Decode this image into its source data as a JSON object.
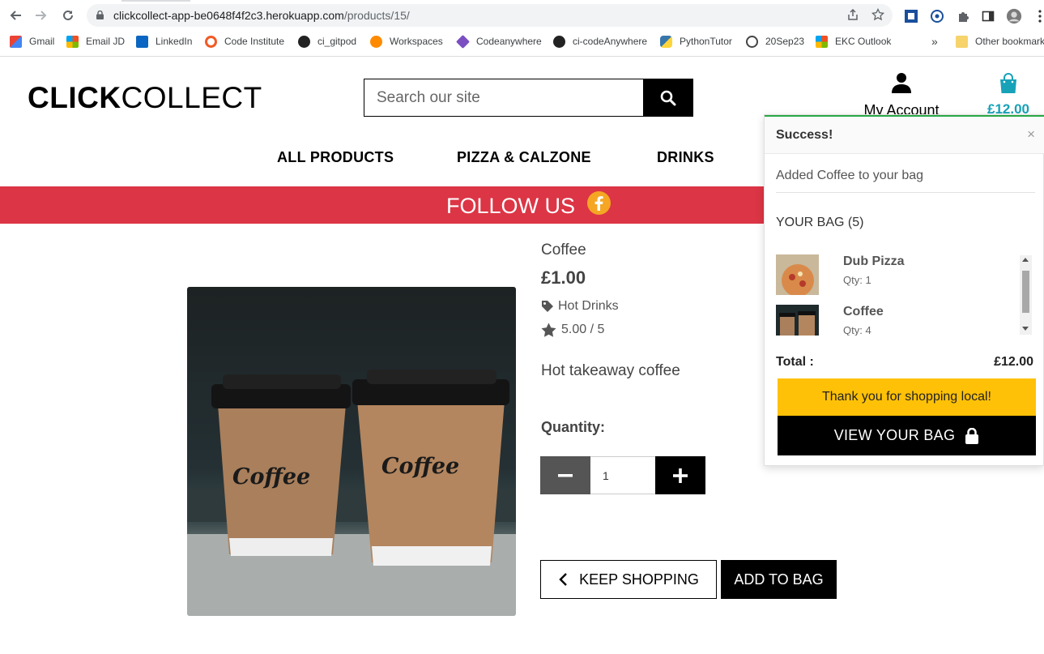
{
  "browser": {
    "url_host": "clickcollect-app-be0648f4f2c3.herokuapp.com",
    "url_path": "/products/15/",
    "bookmarks": [
      "Gmail",
      "Email JD",
      "LinkedIn",
      "Code Institute",
      "ci_gitpod",
      "Workspaces",
      "Codeanywhere",
      "ci-codeAnywhere",
      "PythonTutor",
      "20Sep23",
      "EKC Outlook",
      "Other bookmarks"
    ],
    "overflow_label": "»"
  },
  "header": {
    "logo_bold": "CLICK",
    "logo_light": "COLLECT",
    "search_placeholder": "Search our site",
    "account_label": "My Account",
    "cart_total": "£12.00"
  },
  "nav": {
    "items": [
      "ALL PRODUCTS",
      "PIZZA & CALZONE",
      "DRINKS"
    ]
  },
  "banner": {
    "text": "FOLLOW US",
    "color": "#dc3545"
  },
  "product": {
    "name": "Coffee",
    "price": "£1.00",
    "category": "Hot Drinks",
    "rating": "5.00 / 5",
    "description": "Hot takeaway coffee",
    "quantity_label": "Quantity:",
    "quantity_value": "1",
    "cup_text": "Coffee",
    "keep_shopping": "KEEP SHOPPING",
    "add_to_bag": "ADD TO BAG"
  },
  "toast": {
    "title": "Success!",
    "close": "×",
    "message": "Added Coffee to your bag",
    "bag_heading": "YOUR BAG (5)",
    "items": [
      {
        "name": "Dub Pizza",
        "qty": "Qty: 1"
      },
      {
        "name": "Coffee",
        "qty": "Qty: 4"
      }
    ],
    "total_label": "Total :",
    "total_value": "£12.00",
    "thanks": "Thank you for shopping local!",
    "view_bag": "VIEW YOUR BAG",
    "accent": "#28a745",
    "thanks_color": "#ffc107"
  }
}
